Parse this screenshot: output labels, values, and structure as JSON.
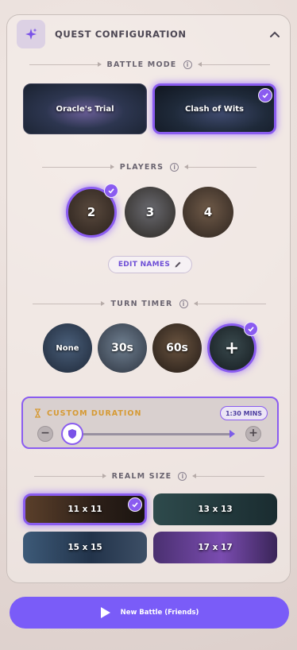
{
  "header": {
    "title": "QUEST CONFIGURATION",
    "icon": "sparkles-icon",
    "collapse_icon": "chevron-up-icon"
  },
  "battle_mode": {
    "label": "BATTLE MODE",
    "options": [
      {
        "label": "Oracle's Trial",
        "selected": false
      },
      {
        "label": "Clash of Wits",
        "selected": true
      }
    ]
  },
  "players": {
    "label": "PLAYERS",
    "options": [
      {
        "label": "2",
        "selected": true
      },
      {
        "label": "3",
        "selected": false
      },
      {
        "label": "4",
        "selected": false
      }
    ],
    "edit_names_label": "EDIT NAMES"
  },
  "turn_timer": {
    "label": "TURN TIMER",
    "options": [
      {
        "label": "None",
        "selected": false
      },
      {
        "label": "30s",
        "selected": false
      },
      {
        "label": "60s",
        "selected": false
      },
      {
        "label": "+",
        "selected": true
      }
    ]
  },
  "custom_duration": {
    "title": "CUSTOM DURATION",
    "value_badge": "1:30 MINS",
    "slider_level_fraction": 0.0,
    "decrement_label": "−",
    "increment_label": "+"
  },
  "realm_size": {
    "label": "REALM SIZE",
    "options": [
      {
        "label": "11 x 11",
        "selected": true
      },
      {
        "label": "13 x 13",
        "selected": false
      },
      {
        "label": "15 x 15",
        "selected": false
      },
      {
        "label": "17 x 17",
        "selected": false
      }
    ]
  },
  "primary_action": {
    "label": "New Battle (Friends)",
    "icon": "play-icon"
  },
  "colors": {
    "accent": "#8a5cf0",
    "button": "#7a5cf8",
    "custom_title": "#d69a34"
  }
}
